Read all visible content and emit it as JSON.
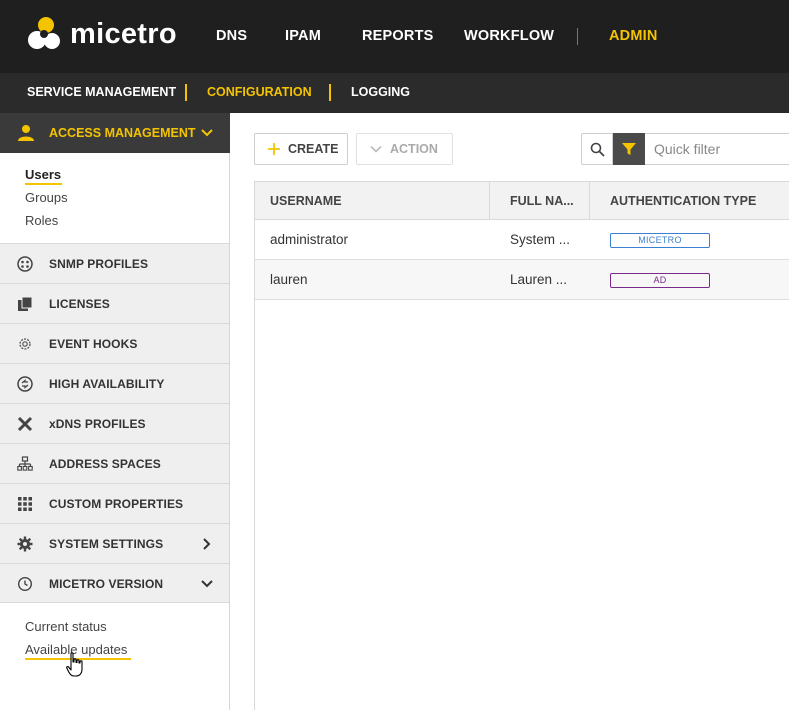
{
  "app": {
    "name": "micetro"
  },
  "top_nav": [
    {
      "label": "DNS"
    },
    {
      "label": "IPAM"
    },
    {
      "label": "REPORTS"
    },
    {
      "label": "WORKFLOW"
    },
    {
      "label": "ADMIN",
      "active": true
    }
  ],
  "sub_nav": [
    {
      "label": "SERVICE MANAGEMENT"
    },
    {
      "label": "CONFIGURATION",
      "active": true
    },
    {
      "label": "LOGGING"
    }
  ],
  "sidebar": {
    "access_management": {
      "label": "ACCESS MANAGEMENT",
      "icon": "person-icon",
      "expanded": true,
      "items": [
        {
          "label": "Users",
          "active": true
        },
        {
          "label": "Groups"
        },
        {
          "label": "Roles"
        }
      ]
    },
    "items": [
      {
        "label": "SNMP PROFILES",
        "icon": "snmp-icon"
      },
      {
        "label": "LICENSES",
        "icon": "licenses-icon"
      },
      {
        "label": "EVENT HOOKS",
        "icon": "gear-outline-icon"
      },
      {
        "label": "HIGH AVAILABILITY",
        "icon": "sync-icon"
      },
      {
        "label": "xDNS PROFILES",
        "icon": "x-icon"
      },
      {
        "label": "ADDRESS SPACES",
        "icon": "hierarchy-icon"
      },
      {
        "label": "CUSTOM PROPERTIES",
        "icon": "grid-icon"
      },
      {
        "label": "SYSTEM SETTINGS",
        "icon": "gear-icon"
      },
      {
        "label": "MICETRO VERSION",
        "icon": "history-icon"
      }
    ],
    "version_items": [
      {
        "label": "Current status"
      },
      {
        "label": "Available updates"
      }
    ]
  },
  "toolbar": {
    "create_label": "CREATE",
    "action_label": "ACTION",
    "quick_filter_placeholder": "Quick filter"
  },
  "table": {
    "columns": [
      "USERNAME",
      "FULL NA...",
      "AUTHENTICATION TYPE"
    ],
    "rows": [
      {
        "username": "administrator",
        "full_name": "System ...",
        "auth_type": "MICETRO"
      },
      {
        "username": "lauren",
        "full_name": "Lauren ...",
        "auth_type": "AD"
      }
    ]
  },
  "colors": {
    "accent": "#f5c400",
    "topbar": "#1f1f1f",
    "micetro_badge": "#3b7fd0",
    "ad_badge": "#7a2a8a"
  }
}
